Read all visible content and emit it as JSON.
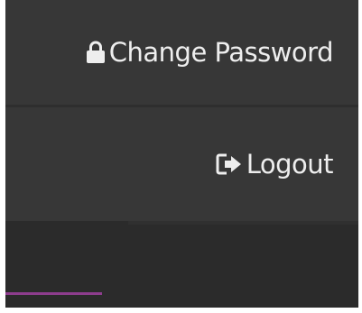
{
  "user_menu": {
    "items": [
      {
        "label": "Change Password",
        "icon": "lock-icon"
      },
      {
        "label": "Logout",
        "icon": "sign-out-icon"
      }
    ]
  },
  "colors": {
    "menu_background": "#373737",
    "page_background": "#2b2b2b",
    "text": "#eeeeee",
    "active_indicator": "#8e3d8e"
  }
}
